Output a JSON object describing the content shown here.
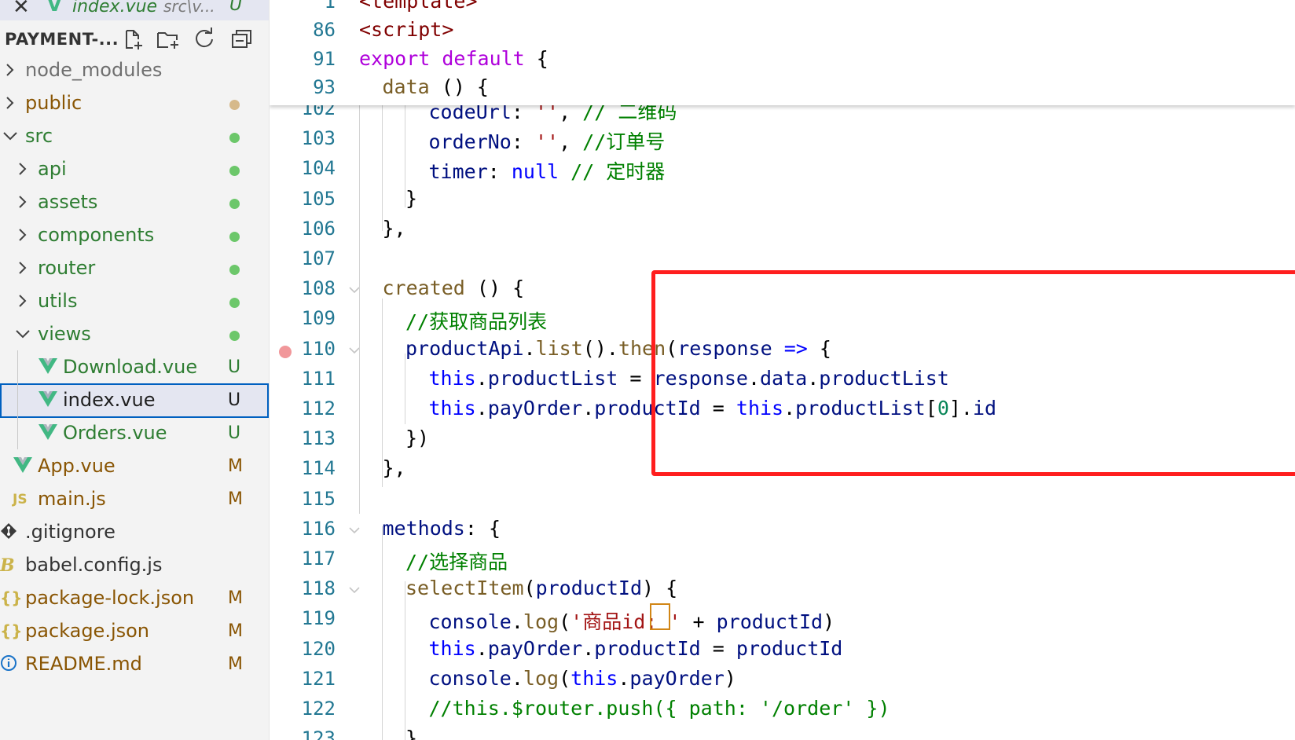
{
  "open_editor": {
    "close": "✕",
    "file": "index.vue",
    "path": "src\\v...",
    "status": "U"
  },
  "explorer": {
    "title": "PAYMENT-...",
    "actions": [
      "new-file",
      "new-folder",
      "refresh",
      "collapse-all"
    ]
  },
  "tree": [
    {
      "label": "node_modules",
      "kind": "folder",
      "collapsed": true,
      "level": 0,
      "color": "#6f6f6f",
      "status_dot": null
    },
    {
      "label": "public",
      "kind": "folder",
      "collapsed": true,
      "level": 0,
      "color": "#895503",
      "status_dot": "#d6b98a"
    },
    {
      "label": "src",
      "kind": "folder",
      "collapsed": false,
      "level": 0,
      "color": "#2e7d32",
      "status_dot": "#6cc76a"
    },
    {
      "label": "api",
      "kind": "folder",
      "collapsed": true,
      "level": 1,
      "color": "#2e7d32",
      "status_dot": "#6cc76a"
    },
    {
      "label": "assets",
      "kind": "folder",
      "collapsed": true,
      "level": 1,
      "color": "#2e7d32",
      "status_dot": "#6cc76a"
    },
    {
      "label": "components",
      "kind": "folder",
      "collapsed": true,
      "level": 1,
      "color": "#2e7d32",
      "status_dot": "#6cc76a"
    },
    {
      "label": "router",
      "kind": "folder",
      "collapsed": true,
      "level": 1,
      "color": "#2e7d32",
      "status_dot": "#6cc76a"
    },
    {
      "label": "utils",
      "kind": "folder",
      "collapsed": true,
      "level": 1,
      "color": "#2e7d32",
      "status_dot": "#6cc76a"
    },
    {
      "label": "views",
      "kind": "folder",
      "collapsed": false,
      "level": 1,
      "color": "#2e7d32",
      "status_dot": "#6cc76a"
    },
    {
      "label": "Download.vue",
      "kind": "vue",
      "level": 2,
      "color": "#2e7d32",
      "badge": "U"
    },
    {
      "label": "index.vue",
      "kind": "vue",
      "level": 2,
      "color": "#1f1f1f",
      "badge": "U",
      "selected": true
    },
    {
      "label": "Orders.vue",
      "kind": "vue",
      "level": 2,
      "color": "#2e7d32",
      "badge": "U"
    },
    {
      "label": "App.vue",
      "kind": "vue",
      "level": 1,
      "color": "#895503",
      "badge": "M"
    },
    {
      "label": "main.js",
      "kind": "js",
      "level": 1,
      "color": "#895503",
      "badge": "M",
      "icon_text": "JS"
    },
    {
      "label": ".gitignore",
      "kind": "git",
      "level": 0,
      "color": "#333333"
    },
    {
      "label": "babel.config.js",
      "kind": "babel",
      "level": 0,
      "color": "#333333"
    },
    {
      "label": "package-lock.json",
      "kind": "json",
      "level": 0,
      "color": "#895503",
      "badge": "M",
      "icon_text": "{}"
    },
    {
      "label": "package.json",
      "kind": "json",
      "level": 0,
      "color": "#895503",
      "badge": "M",
      "icon_text": "{}"
    },
    {
      "label": "README.md",
      "kind": "info",
      "level": 0,
      "color": "#895503",
      "badge": "M",
      "icon_text": "i"
    }
  ],
  "sticky_lines": [
    {
      "n": "1",
      "indent": 0,
      "tokens": [
        [
          "tag",
          "<template>"
        ]
      ]
    },
    {
      "n": "86",
      "indent": 0,
      "tokens": [
        [
          "tag",
          "<script>"
        ]
      ]
    },
    {
      "n": "91",
      "indent": 0,
      "tokens": [
        [
          "ctl",
          "export"
        ],
        [
          "plain",
          " "
        ],
        [
          "ctl",
          "default"
        ],
        [
          "plain",
          " {"
        ]
      ]
    },
    {
      "n": "93",
      "indent": 1,
      "tokens": [
        [
          "fn",
          "data"
        ],
        [
          "plain",
          " () {"
        ]
      ]
    }
  ],
  "code_lines": [
    {
      "n": "102",
      "indent": 3,
      "tokens": [
        [
          "id",
          "codeUrl"
        ],
        [
          "plain",
          ": "
        ],
        [
          "str",
          "''"
        ],
        [
          "plain",
          ", "
        ],
        [
          "cmt",
          "// 二维码"
        ]
      ]
    },
    {
      "n": "103",
      "indent": 3,
      "tokens": [
        [
          "id",
          "orderNo"
        ],
        [
          "plain",
          ": "
        ],
        [
          "str",
          "''"
        ],
        [
          "plain",
          ", "
        ],
        [
          "cmt",
          "//订单号"
        ]
      ]
    },
    {
      "n": "104",
      "indent": 3,
      "tokens": [
        [
          "id",
          "timer"
        ],
        [
          "plain",
          ": "
        ],
        [
          "kw",
          "null"
        ],
        [
          "plain",
          " "
        ],
        [
          "cmt",
          "// 定时器"
        ]
      ]
    },
    {
      "n": "105",
      "indent": 2,
      "tokens": [
        [
          "plain",
          "}"
        ]
      ]
    },
    {
      "n": "106",
      "indent": 1,
      "tokens": [
        [
          "plain",
          "},"
        ]
      ]
    },
    {
      "n": "107",
      "indent": 0,
      "tokens": []
    },
    {
      "n": "108",
      "indent": 1,
      "fold": true,
      "tokens": [
        [
          "fn",
          "created"
        ],
        [
          "plain",
          " () {"
        ]
      ]
    },
    {
      "n": "109",
      "indent": 2,
      "tokens": [
        [
          "cmt",
          "//获取商品列表"
        ]
      ]
    },
    {
      "n": "110",
      "indent": 2,
      "fold": true,
      "breakpoint": true,
      "tokens": [
        [
          "id",
          "productApi"
        ],
        [
          "plain",
          "."
        ],
        [
          "fn",
          "list"
        ],
        [
          "plain",
          "()."
        ],
        [
          "fn",
          "then"
        ],
        [
          "plain",
          "("
        ],
        [
          "id",
          "response"
        ],
        [
          "plain",
          " "
        ],
        [
          "kw",
          "=>"
        ],
        [
          "plain",
          " {"
        ]
      ]
    },
    {
      "n": "111",
      "indent": 3,
      "tokens": [
        [
          "kw",
          "this"
        ],
        [
          "plain",
          "."
        ],
        [
          "id",
          "productList"
        ],
        [
          "plain",
          " = "
        ],
        [
          "id",
          "response"
        ],
        [
          "plain",
          "."
        ],
        [
          "id",
          "data"
        ],
        [
          "plain",
          "."
        ],
        [
          "id",
          "productList"
        ]
      ]
    },
    {
      "n": "112",
      "indent": 3,
      "tokens": [
        [
          "kw",
          "this"
        ],
        [
          "plain",
          "."
        ],
        [
          "id",
          "payOrder"
        ],
        [
          "plain",
          "."
        ],
        [
          "id",
          "productId"
        ],
        [
          "plain",
          " = "
        ],
        [
          "kw",
          "this"
        ],
        [
          "plain",
          "."
        ],
        [
          "id",
          "productList"
        ],
        [
          "plain",
          "["
        ],
        [
          "num",
          "0"
        ],
        [
          "plain",
          "]."
        ],
        [
          "id",
          "id"
        ]
      ]
    },
    {
      "n": "113",
      "indent": 2,
      "tokens": [
        [
          "plain",
          "})"
        ]
      ]
    },
    {
      "n": "114",
      "indent": 1,
      "tokens": [
        [
          "plain",
          "},"
        ]
      ]
    },
    {
      "n": "115",
      "indent": 0,
      "tokens": []
    },
    {
      "n": "116",
      "indent": 1,
      "fold": true,
      "tokens": [
        [
          "id",
          "methods"
        ],
        [
          "plain",
          ": {"
        ]
      ]
    },
    {
      "n": "117",
      "indent": 2,
      "tokens": [
        [
          "cmt",
          "//选择商品"
        ]
      ]
    },
    {
      "n": "118",
      "indent": 2,
      "fold": true,
      "tokens": [
        [
          "fn",
          "selectItem"
        ],
        [
          "plain",
          "("
        ],
        [
          "id",
          "productId"
        ],
        [
          "plain",
          ") {"
        ]
      ]
    },
    {
      "n": "119",
      "indent": 3,
      "tokens": [
        [
          "id",
          "console"
        ],
        [
          "plain",
          "."
        ],
        [
          "fn",
          "log"
        ],
        [
          "plain",
          "("
        ],
        [
          "str",
          "'商品id: '"
        ],
        [
          "plain",
          " + "
        ],
        [
          "id",
          "productId"
        ],
        [
          "plain",
          ")"
        ]
      ]
    },
    {
      "n": "120",
      "indent": 3,
      "tokens": [
        [
          "kw",
          "this"
        ],
        [
          "plain",
          "."
        ],
        [
          "id",
          "payOrder"
        ],
        [
          "plain",
          "."
        ],
        [
          "id",
          "productId"
        ],
        [
          "plain",
          " = "
        ],
        [
          "id",
          "productId"
        ]
      ]
    },
    {
      "n": "121",
      "indent": 3,
      "tokens": [
        [
          "id",
          "console"
        ],
        [
          "plain",
          "."
        ],
        [
          "fn",
          "log"
        ],
        [
          "plain",
          "("
        ],
        [
          "kw",
          "this"
        ],
        [
          "plain",
          "."
        ],
        [
          "id",
          "payOrder"
        ],
        [
          "plain",
          ")"
        ]
      ]
    },
    {
      "n": "122",
      "indent": 3,
      "tokens": [
        [
          "cmt",
          "//this.$router.push({ path: '/order' })"
        ]
      ]
    },
    {
      "n": "123",
      "indent": 2,
      "tokens": [
        [
          "plain",
          "}"
        ]
      ]
    }
  ],
  "colors": {
    "highlight_box": "#ff1e1e",
    "line_numbers": "#237893",
    "breakpoint": "#f1979a",
    "selection_outline": "#0060c0"
  }
}
